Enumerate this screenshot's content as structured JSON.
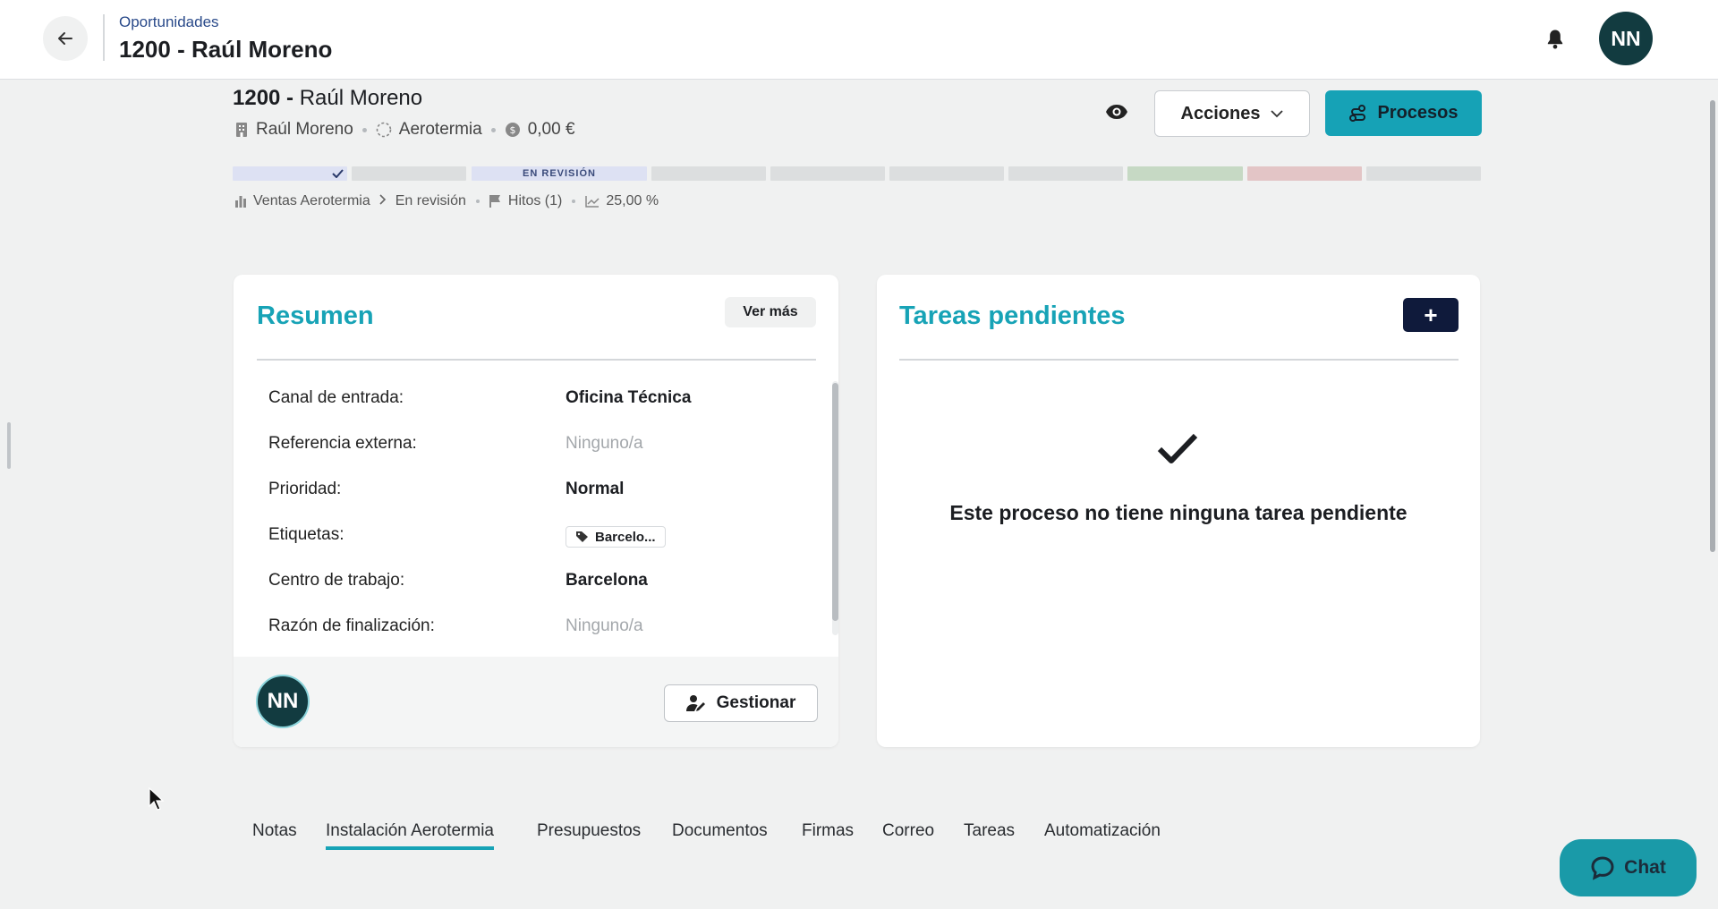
{
  "header": {
    "breadcrumb": "Oportunidades",
    "title": "1200 - Raúl Moreno",
    "user_initials": "NN"
  },
  "record": {
    "id": "1200",
    "separator": " - ",
    "name": "Raúl Moreno",
    "company": "Raúl Moreno",
    "product": "Aerotermia",
    "amount": "0,00 €",
    "actions_label": "Acciones",
    "processes_label": "Procesos"
  },
  "pipeline": {
    "active_stage_label": "EN REVISIÓN",
    "stage_colors": {
      "completed": "#dde1f3",
      "active": "#dde1f3",
      "pending": "#dcdedf",
      "won": "#c6d9c4",
      "lost": "#e3c5c6"
    },
    "pipeline_name": "Ventas Aerotermia",
    "current_stage": "En revisión",
    "milestones": "Hitos (1)",
    "probability": "25,00 %"
  },
  "summary": {
    "title": "Resumen",
    "see_more_label": "Ver más",
    "fields": [
      {
        "label": "Canal de entrada:",
        "value": "Oficina Técnica"
      },
      {
        "label": "Referencia externa:",
        "value": "Ninguno/a"
      },
      {
        "label": "Prioridad:",
        "value": "Normal"
      },
      {
        "label": "Etiquetas:",
        "value": "Barcelo..."
      },
      {
        "label": "Centro de trabajo:",
        "value": "Barcelona"
      },
      {
        "label": "Razón de finalización:",
        "value": "Ninguno/a"
      }
    ],
    "owner_initials": "NN",
    "manage_label": "Gestionar"
  },
  "tasks": {
    "title": "Tareas pendientes",
    "add_label": "+",
    "empty_message": "Este proceso no tiene ninguna tarea pendiente"
  },
  "tabs": [
    {
      "label": "Notas"
    },
    {
      "label": "Instalación Aerotermia"
    },
    {
      "label": "Presupuestos"
    },
    {
      "label": "Documentos"
    },
    {
      "label": "Firmas"
    },
    {
      "label": "Correo"
    },
    {
      "label": "Tareas"
    },
    {
      "label": "Automatización"
    }
  ],
  "chat": {
    "label": "Chat"
  },
  "colors": {
    "accent": "#17a3b6",
    "avatar": "#123b40",
    "dark_button": "#0f1a3b"
  }
}
